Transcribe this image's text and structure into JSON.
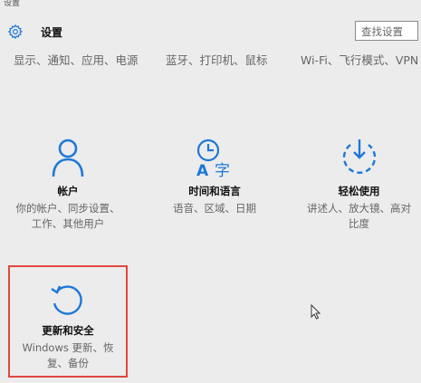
{
  "window": {
    "title": "设置"
  },
  "header": {
    "title": "设置",
    "search_placeholder": "查找设置"
  },
  "top_categories": [
    {
      "desc": "显示、通知、应用、电源"
    },
    {
      "desc": "蓝牙、打印机、鼠标"
    },
    {
      "desc": "Wi-Fi、飞行模式、VPN"
    }
  ],
  "tiles": [
    {
      "title": "帐户",
      "desc1": "你的帐户、同步设置、",
      "desc2": "工作、其他用户",
      "icon": "person-icon"
    },
    {
      "title": "时间和语言",
      "desc1": "语音、区域、日期",
      "desc2": "",
      "icon": "time-language-icon"
    },
    {
      "title": "轻松使用",
      "desc1": "讲述人、放大镜、高对",
      "desc2": "比度",
      "icon": "ease-of-access-icon"
    },
    {
      "title": "更新和安全",
      "desc1": "Windows 更新、恢",
      "desc2": "复、备份",
      "icon": "update-icon"
    }
  ],
  "colors": {
    "accent": "#1e78d7",
    "highlight": "#e0473f",
    "background": "#ececec"
  }
}
